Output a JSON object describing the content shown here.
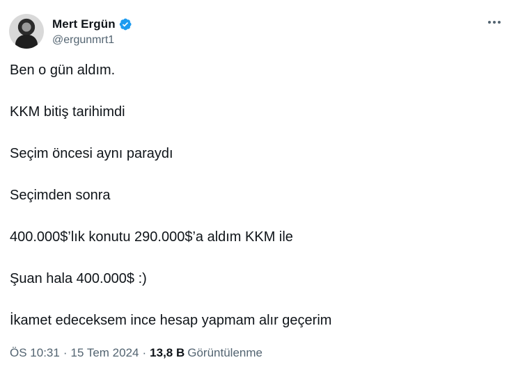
{
  "author": {
    "name": "Mert Ergün",
    "handle": "@ergunmrt1",
    "verified": true
  },
  "tweet": {
    "lines": [
      "Ben o gün aldım.",
      "KKM bitiş tarihimdi",
      "Seçim öncesi aynı paraydı",
      "Seçimden sonra",
      "400.000$’lık konutu 290.000$’a aldım KKM ile",
      "Şuan hala 400.000$ :)",
      "İkamet edeceksem ince hesap yapmam alır geçerim"
    ]
  },
  "meta": {
    "time": "ÖS 10:31",
    "separator": "·",
    "date": "15 Tem 2024",
    "views_count": "13,8 B",
    "views_label": "Görüntülenme"
  },
  "colors": {
    "verified_badge": "#1d9bf0",
    "secondary_text": "#536471",
    "primary_text": "#0f1419"
  },
  "icons": {
    "verified": "verified-badge-icon",
    "more": "more-options-icon"
  }
}
